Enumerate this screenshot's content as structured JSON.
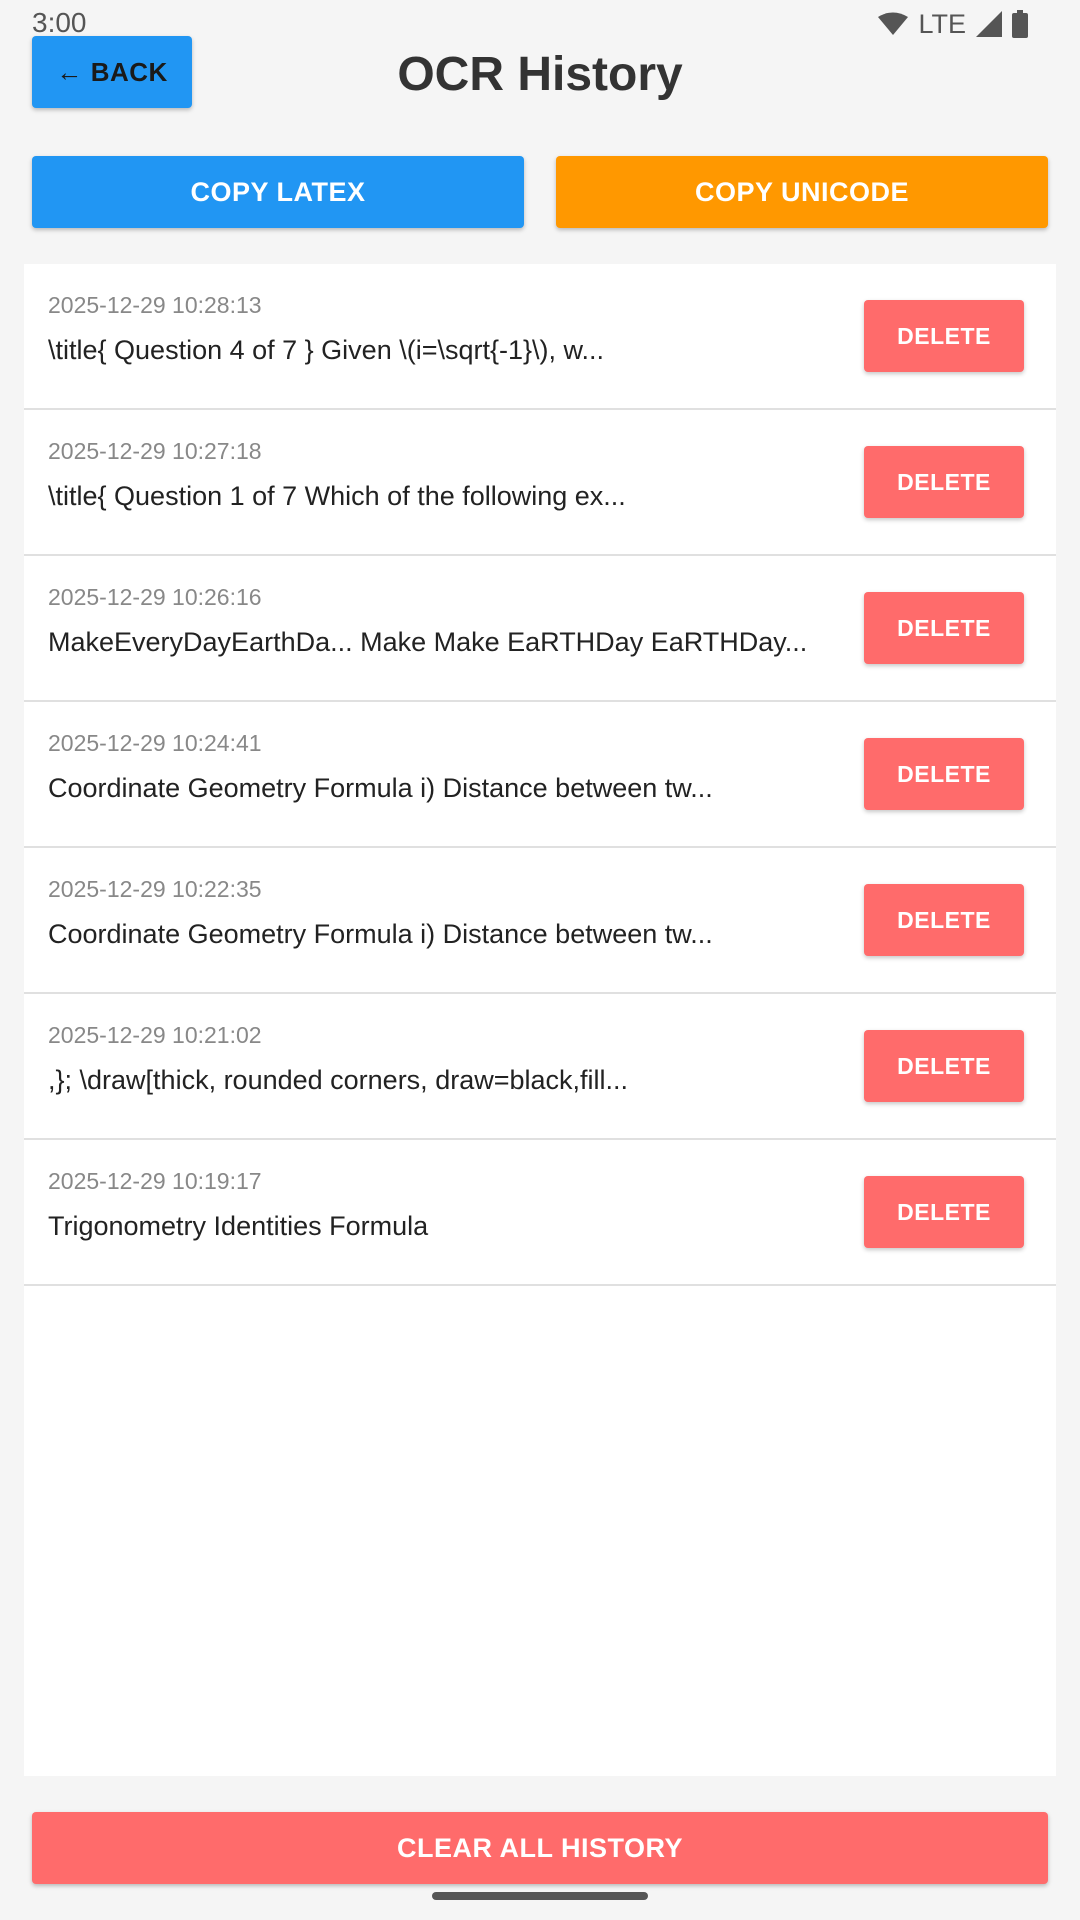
{
  "status_bar": {
    "time": "3:00",
    "network": "LTE",
    "icons": [
      "wifi-icon",
      "cellular-signal-icon",
      "battery-icon"
    ]
  },
  "header": {
    "back_arrow": "←",
    "back_label": "BACK",
    "title": "OCR History"
  },
  "actions": {
    "copy_latex": "COPY LATEX",
    "copy_unicode": "COPY UNICODE",
    "clear_all": "CLEAR ALL HISTORY"
  },
  "history": [
    {
      "timestamp": "2025-12-29 10:28:13",
      "text": "\\title{ Question 4 of 7 } Given \\(i=\\sqrt{-1}\\), w...",
      "delete_label": "DELETE"
    },
    {
      "timestamp": "2025-12-29 10:27:18",
      "text": "\\title{ Question 1 of 7  Which of the following ex...",
      "delete_label": "DELETE"
    },
    {
      "timestamp": "2025-12-29 10:26:16",
      "text": "MakeEveryDayEarthDa... Make Make EaRTHDay EaRTHDay...",
      "delete_label": "DELETE"
    },
    {
      "timestamp": "2025-12-29 10:24:41",
      "text": "Coordinate Geometry Formula i) Distance between tw...",
      "delete_label": "DELETE"
    },
    {
      "timestamp": "2025-12-29 10:22:35",
      "text": "Coordinate Geometry Formula i) Distance between tw...",
      "delete_label": "DELETE"
    },
    {
      "timestamp": "2025-12-29 10:21:02",
      "text": ",};  \\draw[thick, rounded corners, draw=black,fill...",
      "delete_label": "DELETE"
    },
    {
      "timestamp": "2025-12-29 10:19:17",
      "text": "Trigonometry Identities Formula",
      "delete_label": "DELETE"
    }
  ],
  "colors": {
    "primary_blue": "#2196f3",
    "accent_orange": "#ff9800",
    "danger_red": "#ff6b6b",
    "background": "#f5f5f5"
  }
}
